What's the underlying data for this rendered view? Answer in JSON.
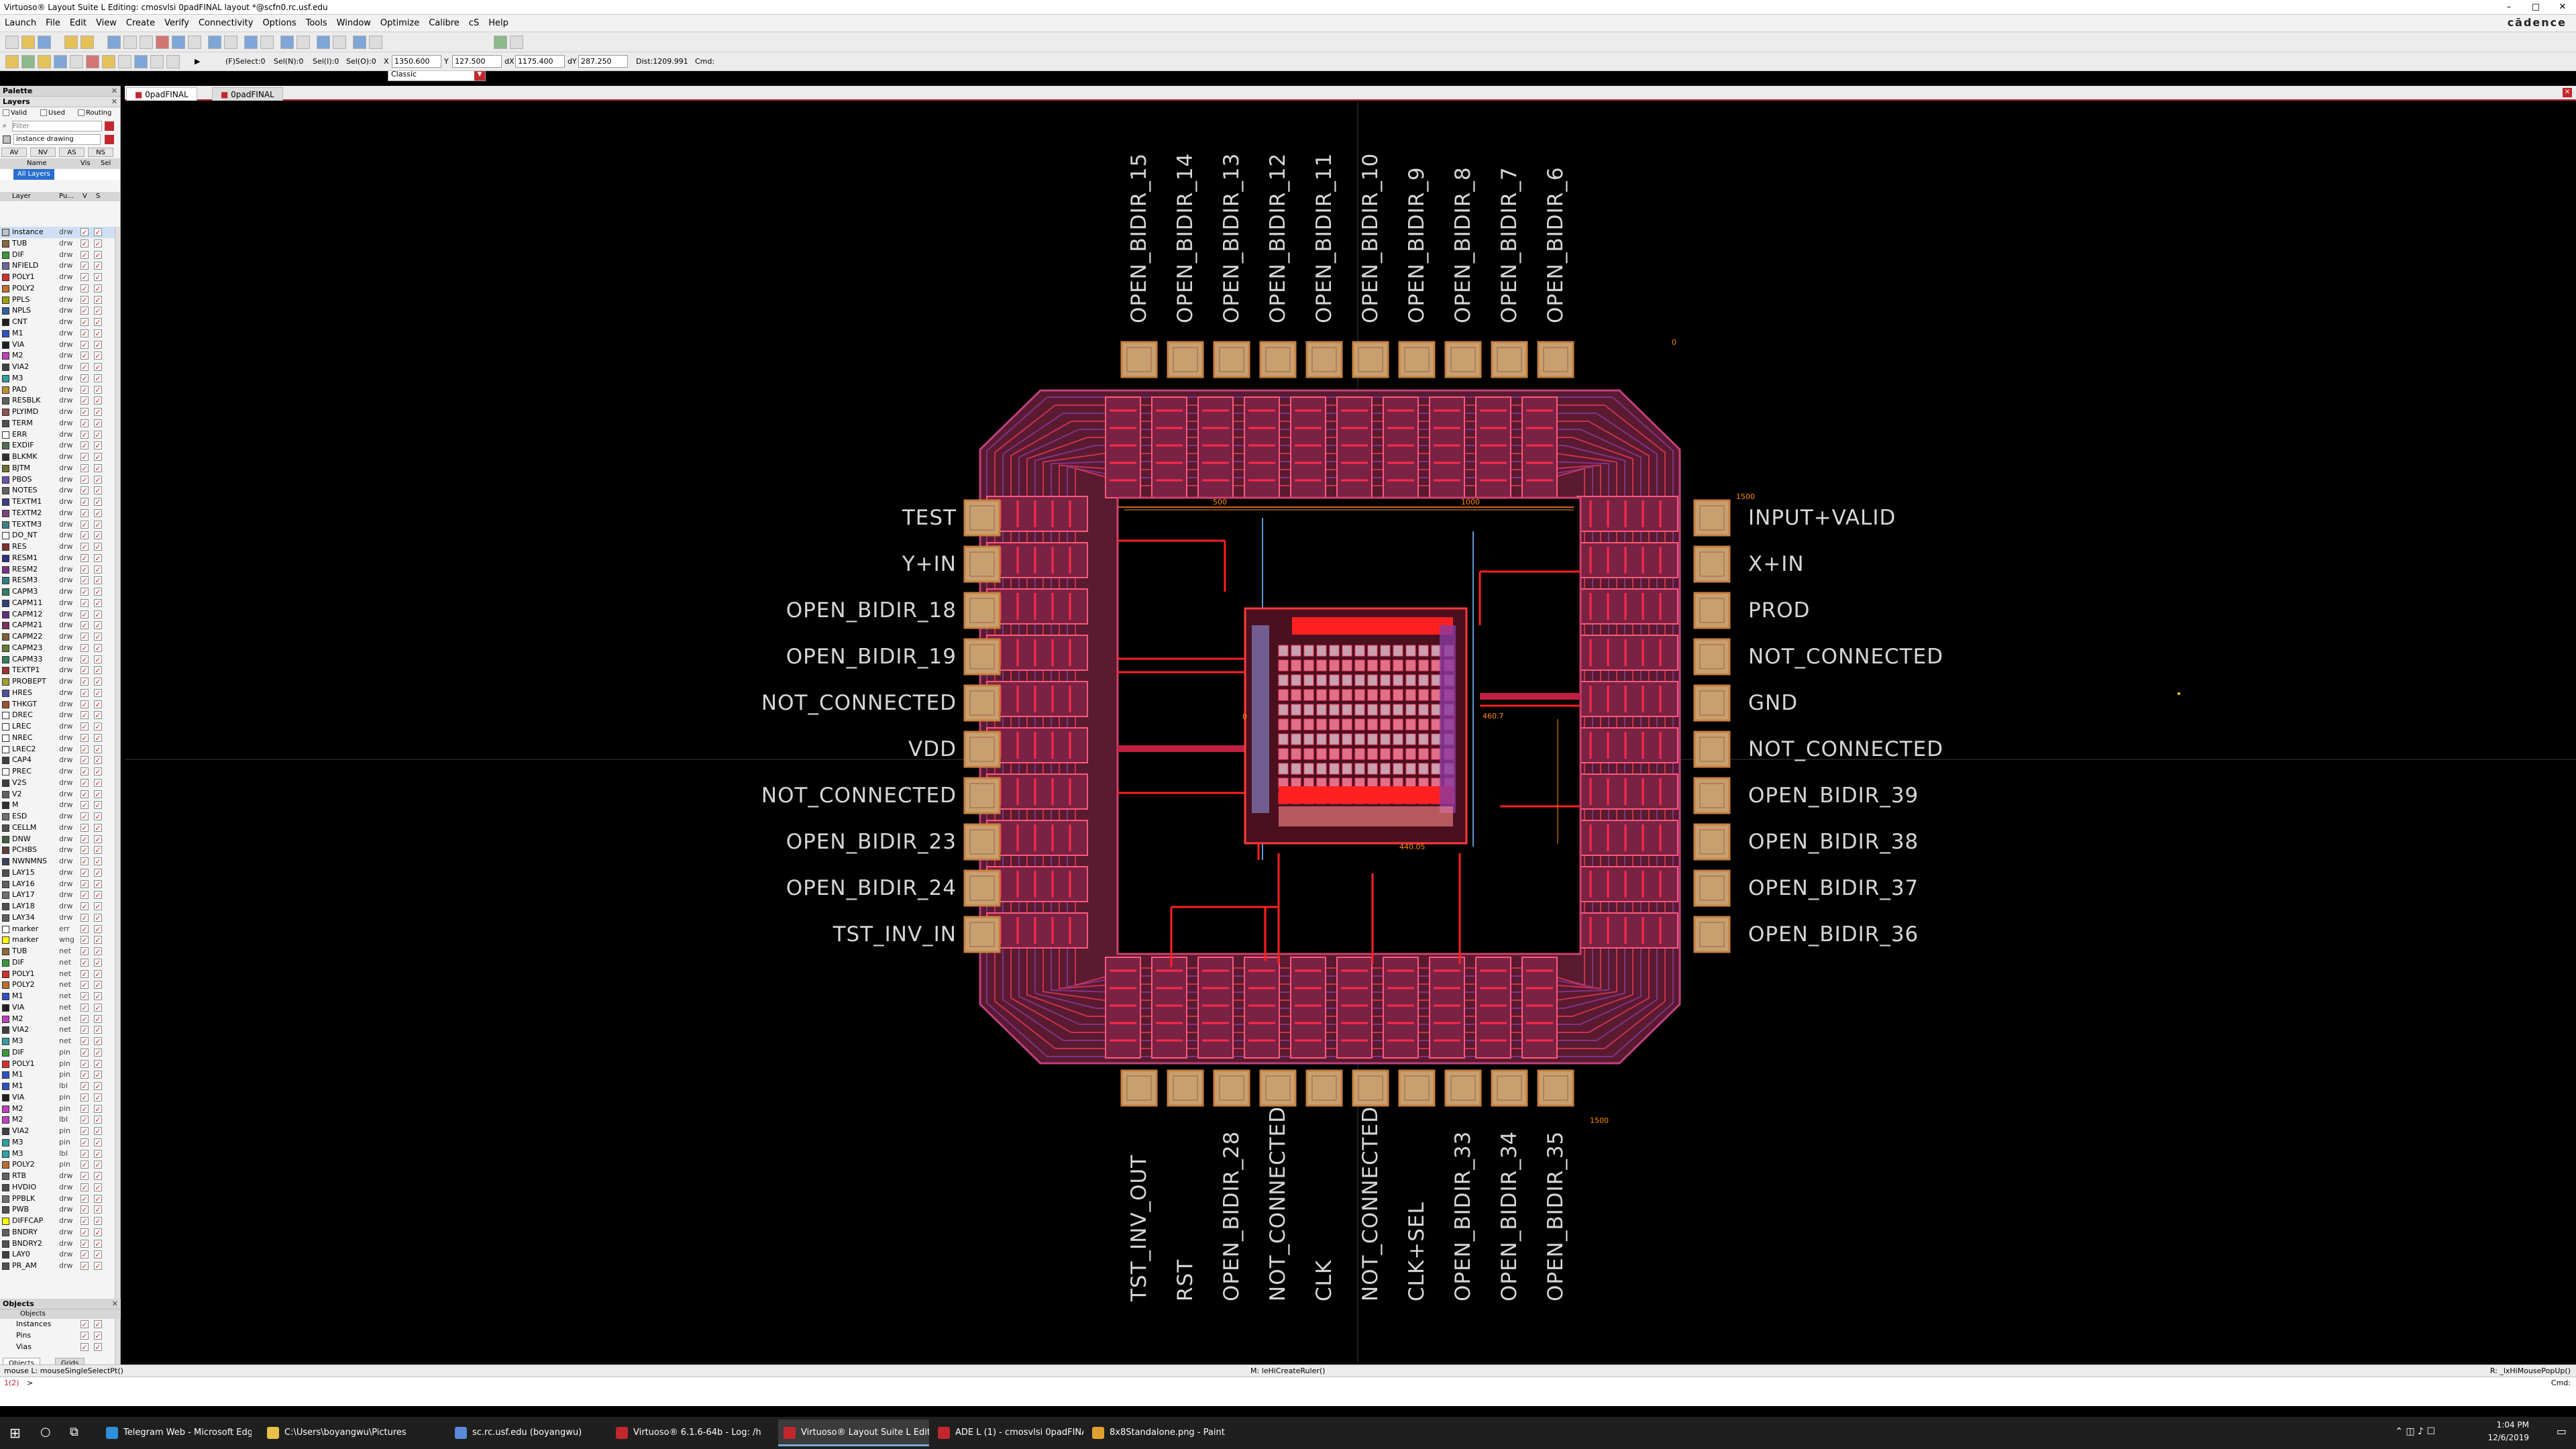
{
  "titlebar": {
    "title": "Virtuoso® Layout Suite L Editing: cmosvlsi 0padFINAL layout *@scfn0.rc.usf.edu",
    "minimize": "–",
    "maximize": "□",
    "close": "✕"
  },
  "brand": "cādence",
  "menus": [
    "Launch",
    "File",
    "Edit",
    "View",
    "Create",
    "Verify",
    "Connectivity",
    "Options",
    "Tools",
    "Window",
    "Optimize",
    "Calibre",
    "cS",
    "Help"
  ],
  "toolbar": {
    "workspace": "Classic",
    "status": {
      "select": "(F)Select:0",
      "sel_n": "Sel(N):0",
      "sel_i": "Sel(I):0",
      "sel_o": "Sel(O):0",
      "x_label": "X",
      "x_value": "1350.600",
      "y_label": "Y",
      "y_value": "127.500",
      "dx_label": "dX",
      "dx_value": "1175.400",
      "dy_label": "dY",
      "dy_value": "287.250",
      "dist": "Dist:1209.991",
      "cmd": "Cmd:"
    }
  },
  "tabs": [
    {
      "label": "0padFINAL",
      "active": true
    },
    {
      "label": "0padFINAL",
      "active": false
    }
  ],
  "panel": {
    "palette_title": "Palette",
    "layers_title": "Layers",
    "filters": [
      "Valid",
      "Used",
      "Routing"
    ],
    "filter_placeholder": "Filter",
    "lpp_mode": "instance drawing",
    "vis_buttons": [
      "AV",
      "NV",
      "AS",
      "NS"
    ],
    "grid_headers": [
      "Name",
      "Vis",
      "Sel"
    ],
    "all_layers": "All Layers",
    "layer_headers": [
      "Layer",
      "Pu...",
      "V",
      "S"
    ],
    "layers": [
      {
        "n": "instance",
        "p": "drw",
        "c": "#c0c0c0"
      },
      {
        "n": "TUB",
        "p": "drw",
        "c": "#8a6a3a"
      },
      {
        "n": "DIF",
        "p": "drw",
        "c": "#3a9a3a"
      },
      {
        "n": "NFIELD",
        "p": "drw",
        "c": "#6a6a9a"
      },
      {
        "n": "POLY1",
        "p": "drw",
        "c": "#d03030"
      },
      {
        "n": "POLY2",
        "p": "drw",
        "c": "#c07030"
      },
      {
        "n": "PPLS",
        "p": "drw",
        "c": "#a0a000"
      },
      {
        "n": "NPLS",
        "p": "drw",
        "c": "#3060a0"
      },
      {
        "n": "CNT",
        "p": "drw",
        "c": "#202020"
      },
      {
        "n": "M1",
        "p": "drw",
        "c": "#3050c0"
      },
      {
        "n": "VIA",
        "p": "drw",
        "c": "#202020"
      },
      {
        "n": "M2",
        "p": "drw",
        "c": "#c040c0"
      },
      {
        "n": "VIA2",
        "p": "drw",
        "c": "#404040"
      },
      {
        "n": "M3",
        "p": "drw",
        "c": "#30a0a0"
      },
      {
        "n": "PAD",
        "p": "drw",
        "c": "#c09030"
      },
      {
        "n": "RESBLK",
        "p": "drw",
        "c": "#606060"
      },
      {
        "n": "PLYIMD",
        "p": "drw",
        "c": "#905050"
      },
      {
        "n": "TERM",
        "p": "drw",
        "c": "#505050"
      },
      {
        "n": "ERR",
        "p": "drw",
        "c": "#ffffff"
      },
      {
        "n": "EXDIF",
        "p": "drw",
        "c": "#507050"
      },
      {
        "n": "BLKMK",
        "p": "drw",
        "c": "#303030"
      },
      {
        "n": "BJTM",
        "p": "drw",
        "c": "#707030"
      },
      {
        "n": "PBOS",
        "p": "drw",
        "c": "#7050a0"
      },
      {
        "n": "NOTES",
        "p": "drw",
        "c": "#606060"
      },
      {
        "n": "TEXTM1",
        "p": "drw",
        "c": "#404080"
      },
      {
        "n": "TEXTM2",
        "p": "drw",
        "c": "#804080"
      },
      {
        "n": "TEXTM3",
        "p": "drw",
        "c": "#408080"
      },
      {
        "n": "DO_NT",
        "p": "drw",
        "c": "#ffffff"
      },
      {
        "n": "RES",
        "p": "drw",
        "c": "#803030"
      },
      {
        "n": "RESM1",
        "p": "drw",
        "c": "#303080"
      },
      {
        "n": "RESM2",
        "p": "drw",
        "c": "#803080"
      },
      {
        "n": "RESM3",
        "p": "drw",
        "c": "#308080"
      },
      {
        "n": "CAPM3",
        "p": "drw",
        "c": "#308060"
      },
      {
        "n": "CAPM11",
        "p": "drw",
        "c": "#304080"
      },
      {
        "n": "CAPM12",
        "p": "drw",
        "c": "#603080"
      },
      {
        "n": "CAPM21",
        "p": "drw",
        "c": "#803060"
      },
      {
        "n": "CAPM22",
        "p": "drw",
        "c": "#806030"
      },
      {
        "n": "CAPM23",
        "p": "drw",
        "c": "#608030"
      },
      {
        "n": "CAPM33",
        "p": "drw",
        "c": "#308060"
      },
      {
        "n": "TEXTP1",
        "p": "drw",
        "c": "#a03030"
      },
      {
        "n": "PROBEPT",
        "p": "drw",
        "c": "#a0a030"
      },
      {
        "n": "HRES",
        "p": "drw",
        "c": "#5050a0"
      },
      {
        "n": "THKGT",
        "p": "drw",
        "c": "#a05030"
      },
      {
        "n": "DREC",
        "p": "drw",
        "c": "#ffffff"
      },
      {
        "n": "LREC",
        "p": "drw",
        "c": "#ffffff"
      },
      {
        "n": "NREC",
        "p": "drw",
        "c": "#ffffff"
      },
      {
        "n": "LREC2",
        "p": "drw",
        "c": "#ffffff"
      },
      {
        "n": "CAP4",
        "p": "drw",
        "c": "#404040"
      },
      {
        "n": "PREC",
        "p": "drw",
        "c": "#ffffff"
      },
      {
        "n": "V2S",
        "p": "drw",
        "c": "#404040"
      },
      {
        "n": "V2",
        "p": "drw",
        "c": "#606060"
      },
      {
        "n": "M",
        "p": "drw",
        "c": "#303030"
      },
      {
        "n": "ESD",
        "p": "drw",
        "c": "#707070"
      },
      {
        "n": "CELLM",
        "p": "drw",
        "c": "#505050"
      },
      {
        "n": "DNW",
        "p": "drw",
        "c": "#406040"
      },
      {
        "n": "PCHBS",
        "p": "drw",
        "c": "#604040"
      },
      {
        "n": "NWNMNS",
        "p": "drw",
        "c": "#404060"
      },
      {
        "n": "LAY15",
        "p": "drw",
        "c": "#505050"
      },
      {
        "n": "LAY16",
        "p": "drw",
        "c": "#606060"
      },
      {
        "n": "LAY17",
        "p": "drw",
        "c": "#707070"
      },
      {
        "n": "LAY18",
        "p": "drw",
        "c": "#505050"
      },
      {
        "n": "LAY34",
        "p": "drw",
        "c": "#606060"
      },
      {
        "n": "marker",
        "p": "err",
        "c": "#ffffff"
      },
      {
        "n": "marker",
        "p": "wng",
        "c": "#ffff00"
      },
      {
        "n": "TUB",
        "p": "net",
        "c": "#8a6a3a"
      },
      {
        "n": "DIF",
        "p": "net",
        "c": "#3a9a3a"
      },
      {
        "n": "POLY1",
        "p": "net",
        "c": "#d03030"
      },
      {
        "n": "POLY2",
        "p": "net",
        "c": "#c07030"
      },
      {
        "n": "M1",
        "p": "net",
        "c": "#3050c0"
      },
      {
        "n": "VIA",
        "p": "net",
        "c": "#202020"
      },
      {
        "n": "M2",
        "p": "net",
        "c": "#c040c0"
      },
      {
        "n": "VIA2",
        "p": "net",
        "c": "#404040"
      },
      {
        "n": "M3",
        "p": "net",
        "c": "#30a0a0"
      },
      {
        "n": "DIF",
        "p": "pin",
        "c": "#3a9a3a"
      },
      {
        "n": "POLY1",
        "p": "pin",
        "c": "#d03030"
      },
      {
        "n": "M1",
        "p": "pin",
        "c": "#3050c0"
      },
      {
        "n": "M1",
        "p": "lbl",
        "c": "#3050c0"
      },
      {
        "n": "VIA",
        "p": "pin",
        "c": "#202020"
      },
      {
        "n": "M2",
        "p": "pin",
        "c": "#c040c0"
      },
      {
        "n": "M2",
        "p": "lbl",
        "c": "#c040c0"
      },
      {
        "n": "VIA2",
        "p": "pin",
        "c": "#404040"
      },
      {
        "n": "M3",
        "p": "pin",
        "c": "#30a0a0"
      },
      {
        "n": "M3",
        "p": "lbl",
        "c": "#30a0a0"
      },
      {
        "n": "POLY2",
        "p": "pin",
        "c": "#c07030"
      },
      {
        "n": "RTB",
        "p": "drw",
        "c": "#606060"
      },
      {
        "n": "HVDIO",
        "p": "drw",
        "c": "#505050"
      },
      {
        "n": "PPBLK",
        "p": "drw",
        "c": "#707070"
      },
      {
        "n": "PWB",
        "p": "drw",
        "c": "#505050"
      },
      {
        "n": "DIFFCAP",
        "p": "drw",
        "c": "#ffff00"
      },
      {
        "n": "BNDRY",
        "p": "drw",
        "c": "#606060"
      },
      {
        "n": "BNDRY2",
        "p": "drw",
        "c": "#505050"
      },
      {
        "n": "LAY0",
        "p": "drw",
        "c": "#404040"
      },
      {
        "n": "PR_AM",
        "p": "drw",
        "c": "#505050"
      }
    ],
    "objects_title": "Objects",
    "objects_header": "Objects",
    "objects": [
      "Instances",
      "Pins",
      "Vias"
    ],
    "bottom_tabs": [
      "Objects",
      "Grids"
    ]
  },
  "pads": {
    "top": [
      "OPEN_BIDIR_15",
      "OPEN_BIDIR_14",
      "OPEN_BIDIR_13",
      "OPEN_BIDIR_12",
      "OPEN_BIDIR_11",
      "OPEN_BIDIR_10",
      "OPEN_BIDIR_9",
      "OPEN_BIDIR_8",
      "OPEN_BIDIR_7",
      "OPEN_BIDIR_6"
    ],
    "left": [
      "TEST",
      "Y+IN",
      "OPEN_BIDIR_18",
      "OPEN_BIDIR_19",
      "NOT_CONNECTED",
      "VDD",
      "NOT_CONNECTED",
      "OPEN_BIDIR_23",
      "OPEN_BIDIR_24",
      "TST_INV_IN"
    ],
    "right": [
      "INPUT+VALID",
      "X+IN",
      "PROD",
      "NOT_CONNECTED",
      "GND",
      "NOT_CONNECTED",
      "OPEN_BIDIR_39",
      "OPEN_BIDIR_38",
      "OPEN_BIDIR_37",
      "OPEN_BIDIR_36"
    ],
    "bottom": [
      "TST_INV_OUT",
      "RST",
      "OPEN_BIDIR_28",
      "NOT_CONNECTED",
      "CLK",
      "NOT_CONNECTED",
      "CLK+SEL",
      "OPEN_BIDIR_33",
      "OPEN_BIDIR_34",
      "OPEN_BIDIR_35"
    ]
  },
  "canvas_marks": {
    "origin": "0",
    "top_right": "0",
    "bottom_right": "1500",
    "right_ruler": "1500",
    "ruler_a": "500",
    "ruler_b": "1000",
    "dim_a": "460.7",
    "dim_b": "440.05"
  },
  "colors": {
    "accent": "#c2272d",
    "pad_fill": "#c8a070",
    "pad_border": "#c88040",
    "ring_metal": "#b02850",
    "ring_mesh": "#e03a5a",
    "core_route": "#ff2020",
    "label": "#d6d6d6",
    "ruler": "#ff8c00"
  },
  "statusbar": {
    "left": "mouse L: mouseSingleSelectPt()",
    "mid": "M: leHiCreateRuler()",
    "right": "R: _lxHiMousePopUp()"
  },
  "cmdline": {
    "prompt": "1(2)",
    "arrow": ">",
    "right": "Cmd:"
  },
  "taskbar": {
    "apps": [
      {
        "label": "Telegram Web - Microsoft Edge",
        "color": "#2f8fd8",
        "active": false
      },
      {
        "label": "C:\\Users\\boyangwu\\Pictures",
        "color": "#e8c14a",
        "active": false
      },
      {
        "label": "sc.rc.usf.edu (boyangwu)",
        "color": "#5a8ad8",
        "active": false
      },
      {
        "label": "Virtuoso® 6.1.6-64b - Log: /home/...",
        "color": "#c2272d",
        "active": false
      },
      {
        "label": "Virtuoso® Layout Suite L Editing: c...",
        "color": "#c2272d",
        "active": true
      },
      {
        "label": "ADE L (1) - cmosvlsi 0padFINAL c...",
        "color": "#c2272d",
        "active": false
      },
      {
        "label": "8x8Standalone.png - Paint",
        "color": "#e0a030",
        "active": false
      }
    ],
    "time": "1:04 PM",
    "date": "12/6/2019"
  }
}
